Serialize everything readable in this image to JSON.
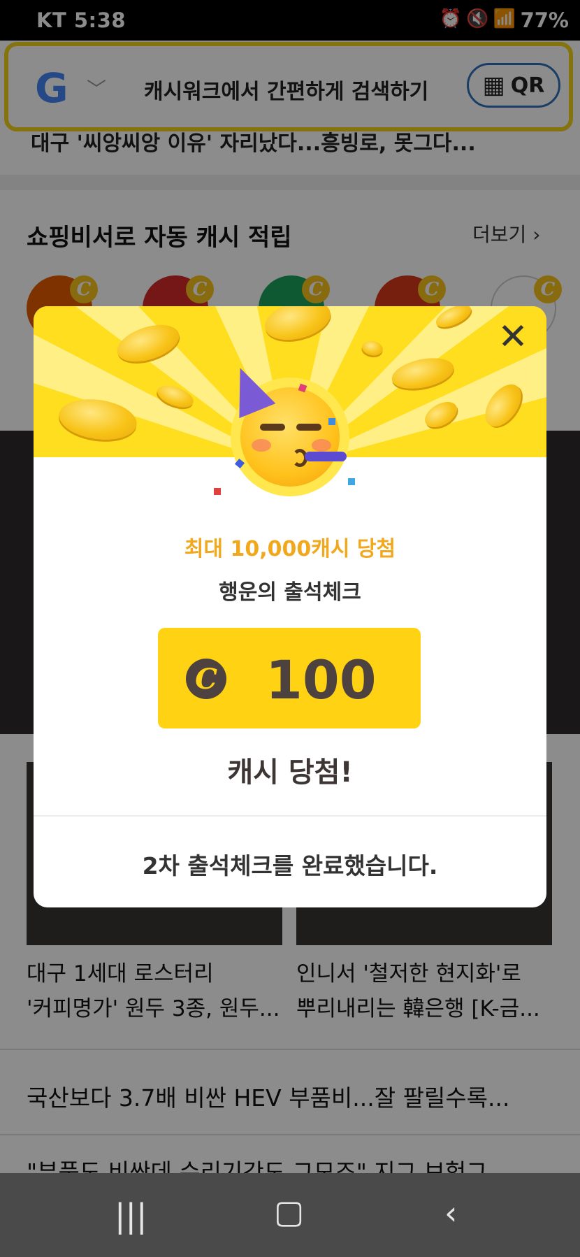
{
  "status_bar": {
    "carrier": "KT",
    "time": "5:38",
    "left_icons": [
      "talk-icon",
      "chat-icon",
      "flashlight-icon",
      "dot-icon"
    ],
    "right_icons": [
      "alarm-icon",
      "mute-icon",
      "wifi-icon",
      "hd-icon",
      "signal-icon"
    ],
    "battery": "77%"
  },
  "search_bar": {
    "engine_icon": "google-icon",
    "hint": "캐시워크에서 간편하게 검색하기",
    "qr_label": "QR"
  },
  "behind": {
    "partial_headline": "대구 '씨앙씨앙 이유' 자리났다...흥빙로, 못그다...",
    "section_title": "쇼핑비서로 자동 캐시 적립",
    "more_label": "더보기",
    "shop_badge": "C",
    "shop_colors": [
      "#e65c00",
      "#d72b2b",
      "#1aa35a",
      "#d83a1a",
      "#ffffff"
    ],
    "news": [
      {
        "title_line1": "대구 1세대 로스터리",
        "title_line2": "'커피명가' 원두 3종, 원두..."
      },
      {
        "title_line1": "인니서 '철저한 현지화'로",
        "title_line2": "뿌리내리는 韓은행 [K-금..."
      }
    ],
    "headline_1": "국산보다 3.7배 비싼 HEV 부품비...잘 팔릴수록...",
    "headline_2": "\"부품도 비싼데 수리기간도 그모죠\" 지그 보험그"
  },
  "modal": {
    "close_icon": "close-icon",
    "promo": "최대 10,000캐시 당첨",
    "subtitle": "행운의 출석체크",
    "coin_symbol": "C",
    "amount": "100",
    "result": "캐시 당첨!",
    "footer": "2차 출석체크를 완료했습니다.",
    "colors": {
      "top_bg": "#ffdd1f",
      "promo": "#f2a81d",
      "amount_box": "#ffd313",
      "text_dark": "#4e4240"
    }
  },
  "nav_bar": {
    "recent_icon": "recent-apps-icon",
    "home_icon": "home-icon",
    "back_icon": "back-icon"
  }
}
